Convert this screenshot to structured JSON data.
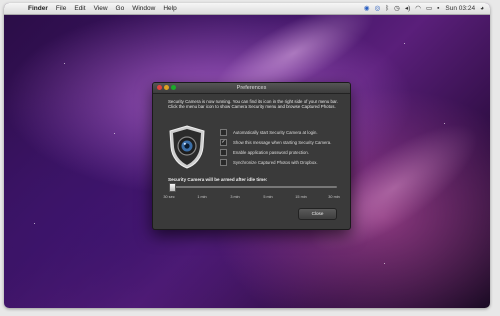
{
  "menubar": {
    "apple_icon": "apple-icon",
    "items": [
      "Finder",
      "File",
      "Edit",
      "View",
      "Go",
      "Window",
      "Help"
    ],
    "clock": "Sun 03:24",
    "status_icons": [
      "camera-icon",
      "search-icon",
      "bluetooth-icon",
      "time-machine-icon",
      "volume-icon",
      "wifi-icon",
      "battery-icon",
      "flag-icon",
      "user-icon"
    ]
  },
  "window": {
    "title": "Preferences",
    "intro": "Security Camera is now running. You can find its icon in the right side of your menu bar. Click the menu bar icon to show Camera Security menu and browse Captured Photos.",
    "options": [
      {
        "label": "Automatically start Security Camera at login.",
        "checked": false
      },
      {
        "label": "Show this message when starting Security Camera.",
        "checked": true
      },
      {
        "label": "Enable application password protection.",
        "checked": false
      },
      {
        "label": "Synchronize Captured Photos with Dropbox.",
        "checked": false
      }
    ],
    "arm_label": "Security Camera will be armed after idle time:",
    "slider": {
      "ticks": [
        "30 sec",
        "1 min",
        "3 min",
        "5 min",
        "15 min",
        "30 min"
      ],
      "value_index": 0
    },
    "close_label": "Close"
  }
}
